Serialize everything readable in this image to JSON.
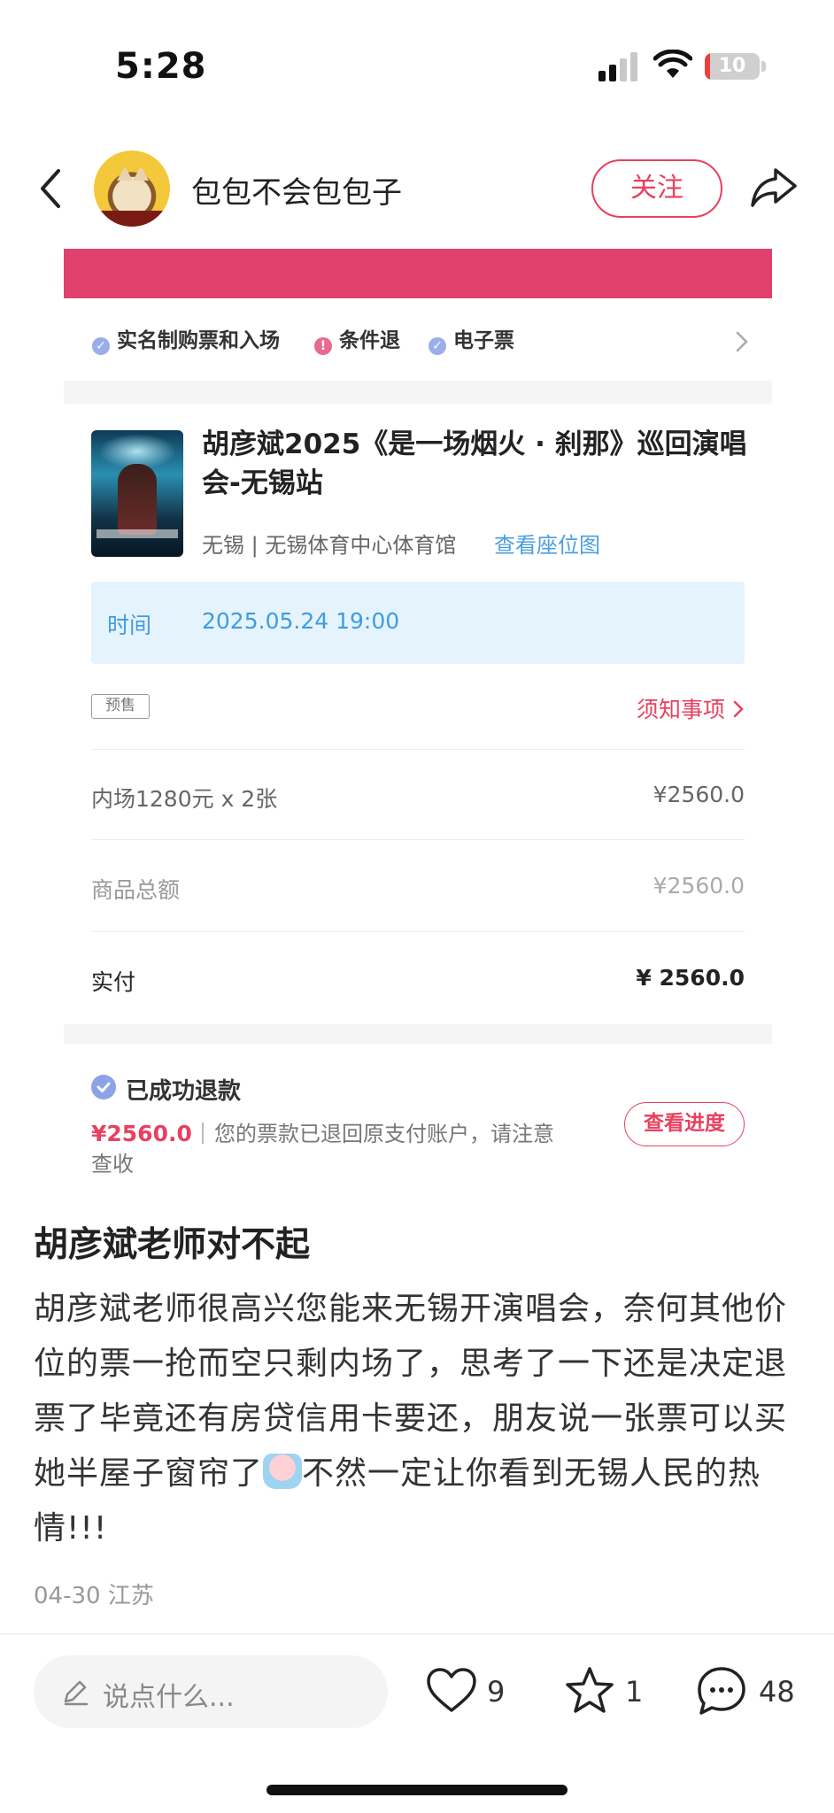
{
  "status_bar": {
    "time": "5:28",
    "battery": "10",
    "battery_level": 0.1
  },
  "header": {
    "author": "包包不会包包子",
    "follow_label": "关注"
  },
  "ticket": {
    "tags": [
      {
        "label": "实名制购票和入场",
        "icon": "check-circle-icon",
        "color": "#9aaeea"
      },
      {
        "label": "条件退",
        "icon": "exclamation-circle-icon",
        "color": "#e86a8f"
      },
      {
        "label": "电子票",
        "icon": "check-circle-icon",
        "color": "#9aaeea"
      }
    ],
    "event_title": "胡彦斌2025《是一场烟火 · 刹那》巡回演唱会-无锡站",
    "venue": "无锡 | 无锡体育中心体育馆",
    "seatmap_link": "查看座位图",
    "time_label": "时间",
    "time_value": "2025.05.24 19:00",
    "presale_badge": "预售",
    "notice_link": "须知事项",
    "item_label": "内场1280元 x 2张",
    "item_price": "¥2560.0",
    "total_label": "商品总额",
    "total_value": "¥2560.0",
    "paid_label": "实付",
    "paid_value": "¥ 2560.0",
    "refund_title": "已成功退款",
    "refund_amount": "¥2560.0",
    "refund_desc": "您的票款已退回原支付账户，请注意",
    "refund_desc_2": "查收",
    "refund_button": "查看进度"
  },
  "post": {
    "title": "胡彦斌老师对不起",
    "body_before_emoji": "胡彦斌老师很高兴您能来无锡开演唱会，奈何其他价位的票一抢而空只剩内场了，思考了一下还是决定退票了毕竟还有房贷信用卡要还，朋友说一张票可以买她半屋子窗帘了",
    "emoji": "crying-emoji",
    "body_after_emoji": "不然一定让你看到无锡人民的热情!!!",
    "meta": "04-30 江苏"
  },
  "bottom_bar": {
    "comment_placeholder": "说点什么...",
    "likes": "9",
    "favorites": "1",
    "comments": "48"
  },
  "colors": {
    "accent": "#e8415f",
    "link": "#4a9ee0",
    "banner": "#e0416c"
  }
}
